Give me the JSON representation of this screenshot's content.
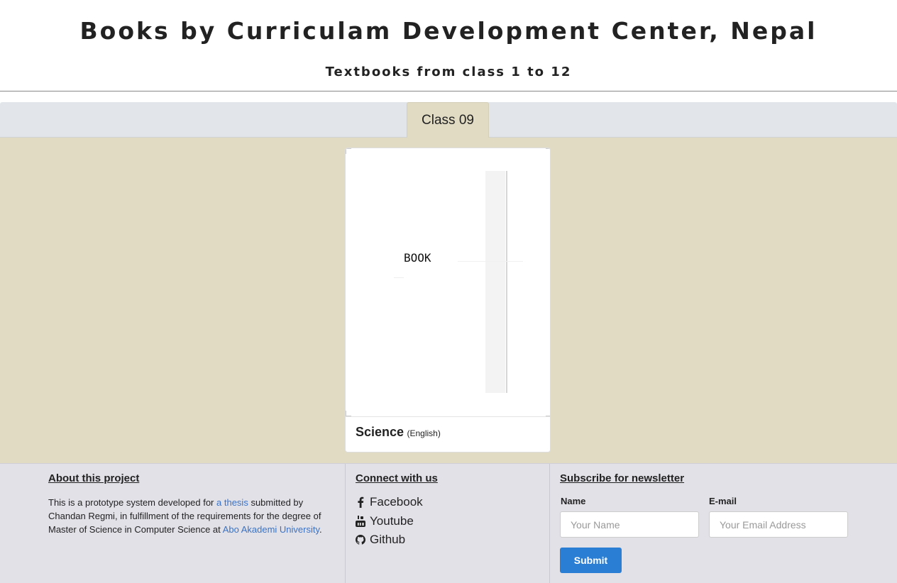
{
  "header": {
    "title": "Books by Curriculam Development Center, Nepal",
    "subtitle": "Textbooks from class 1 to 12"
  },
  "tabs": [
    {
      "label": "Class 09",
      "active": true
    }
  ],
  "books": [
    {
      "cover_text": "BOOK",
      "title": "Science",
      "language": "(English)"
    }
  ],
  "footer": {
    "about": {
      "heading": "About this project",
      "text_before": "This is a prototype system developed for ",
      "thesis_link": "a thesis",
      "text_middle": " submitted by Chandan Regmi, in fulfillment of the requirements for the degree of Master of Science in Computer Science at ",
      "university_link": "Abo Akademi University",
      "text_after": "."
    },
    "connect": {
      "heading": "Connect with us",
      "links": [
        {
          "label": "Facebook",
          "icon": "facebook-icon"
        },
        {
          "label": "Youtube",
          "icon": "youtube-icon"
        },
        {
          "label": "Github",
          "icon": "github-icon"
        }
      ]
    },
    "newsletter": {
      "heading": "Subscribe for newsletter",
      "name_label": "Name",
      "name_placeholder": "Your Name",
      "email_label": "E-mail",
      "email_placeholder": "Your Email Address",
      "submit_label": "Submit"
    }
  },
  "colors": {
    "content_bg": "#e1dbc4",
    "footer_bg": "#e3e1e8",
    "link": "#3a72c4",
    "submit_bg": "#2a7fd4"
  }
}
